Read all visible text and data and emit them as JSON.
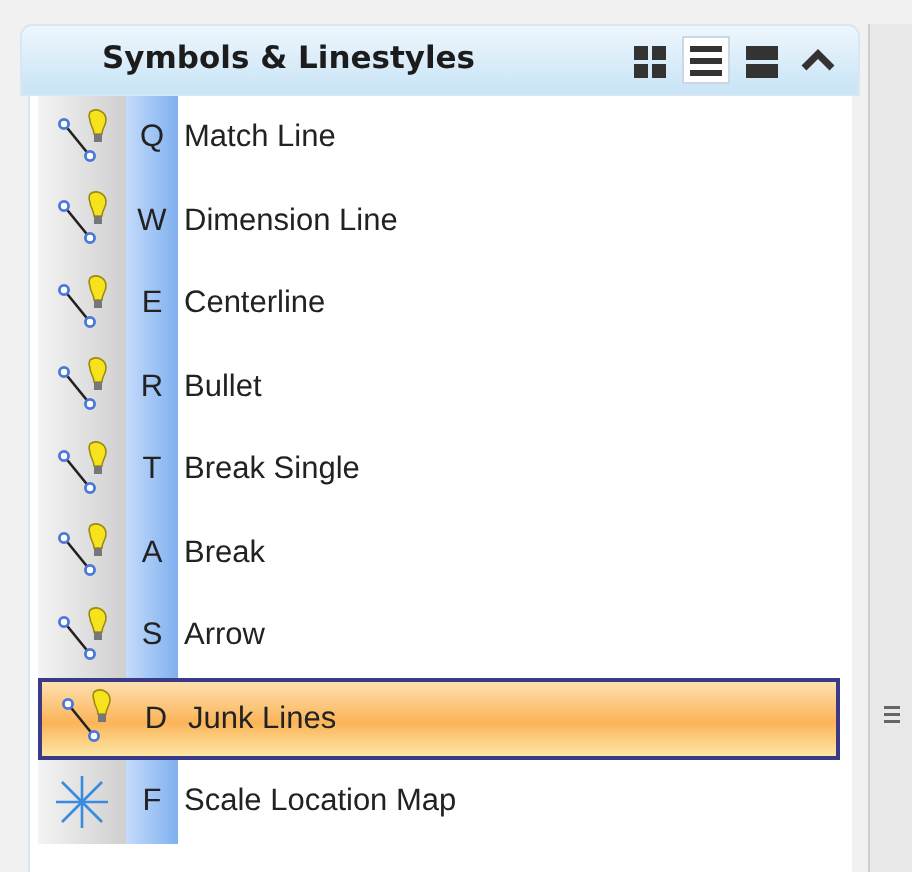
{
  "panel": {
    "title": "Symbols & Linestyles",
    "view_buttons": [
      {
        "kind": "tiles",
        "selected": false
      },
      {
        "kind": "list",
        "selected": true
      },
      {
        "kind": "details",
        "selected": false
      }
    ],
    "collapse_button": {
      "kind": "collapse"
    }
  },
  "items": [
    {
      "key": "Q",
      "label": "Match Line",
      "kind": "linestyle",
      "selected": false
    },
    {
      "key": "W",
      "label": "Dimension Line",
      "kind": "linestyle",
      "selected": false
    },
    {
      "key": "E",
      "label": "Centerline",
      "kind": "linestyle",
      "selected": false
    },
    {
      "key": "R",
      "label": "Bullet",
      "kind": "linestyle",
      "selected": false
    },
    {
      "key": "T",
      "label": "Break Single",
      "kind": "linestyle",
      "selected": false
    },
    {
      "key": "A",
      "label": "Break",
      "kind": "linestyle",
      "selected": false
    },
    {
      "key": "S",
      "label": "Arrow",
      "kind": "linestyle",
      "selected": false
    },
    {
      "key": "D",
      "label": "Junk Lines",
      "kind": "linestyle",
      "selected": true
    },
    {
      "key": "F",
      "label": "Scale Location Map",
      "kind": "symbol",
      "selected": false
    }
  ]
}
